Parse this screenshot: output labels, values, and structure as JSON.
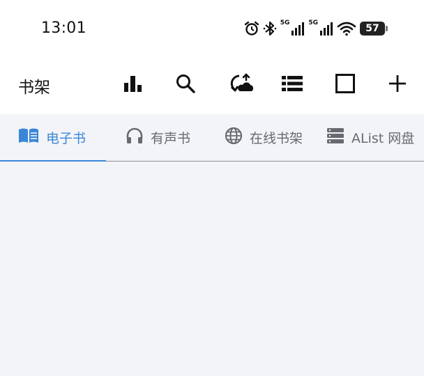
{
  "status_bar": {
    "time": "13:01",
    "network_1": "5G",
    "network_2": "5G",
    "battery": "57",
    "icons": [
      "alarm-icon",
      "bluetooth-icon",
      "signal-icon",
      "signal-icon",
      "wifi-icon",
      "battery-icon"
    ]
  },
  "app_bar": {
    "title": "书架",
    "actions": [
      "bar-chart-icon",
      "search-icon",
      "sync-icon",
      "list-view-icon",
      "select-square-icon",
      "add-icon"
    ]
  },
  "tabs": [
    {
      "label": "电子书",
      "icon": "book-icon",
      "active": true
    },
    {
      "label": "有声书",
      "icon": "headphones-icon",
      "active": false
    },
    {
      "label": "在线书架",
      "icon": "globe-icon",
      "active": false
    },
    {
      "label": "AList 网盘",
      "icon": "storage-icon",
      "active": false
    }
  ],
  "colors": {
    "accent": "#3a86d8",
    "background": "#f3f4f7",
    "surface": "#ffffff",
    "tab_inactive": "#666a70"
  }
}
